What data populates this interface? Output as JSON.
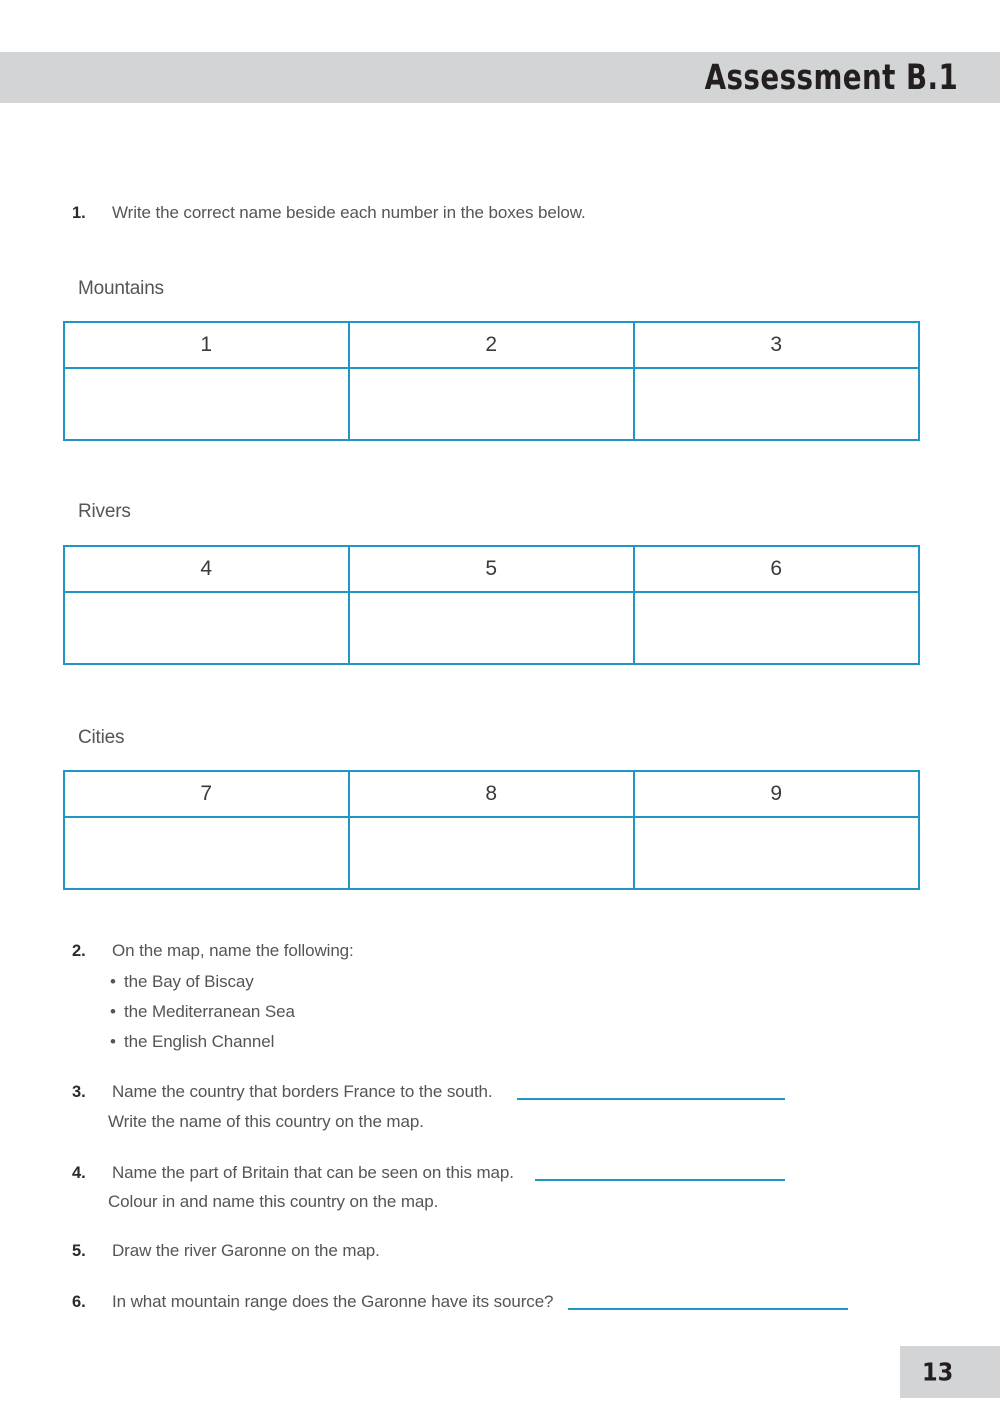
{
  "header": {
    "title": "Assessment B.1",
    "bar_color": "#d3d4d6"
  },
  "theme": {
    "accent_color": "#2196c4",
    "text_color": "#555556",
    "number_color": "#2b2b2b"
  },
  "questions": [
    {
      "number": "1.",
      "text": "Write the correct name beside each number in the boxes below."
    },
    {
      "number": "2.",
      "text": "On the map, name the following:",
      "bullets": [
        "the Bay of Biscay",
        "the Mediterranean Sea",
        "the English Channel"
      ]
    },
    {
      "number": "3.",
      "text": "Name the country that borders France to the south.",
      "sub_text": "Write the name of this country on the map.",
      "answer_line": true
    },
    {
      "number": "4.",
      "text": "Name the part of Britain that can be seen on this map.",
      "sub_text": "Colour in and name this country on the map.",
      "answer_line": true
    },
    {
      "number": "5.",
      "text": "Draw the river Garonne on the map.",
      "answer_line": false
    },
    {
      "number": "6.",
      "text": "In what mountain range does the Garonne have its source?",
      "answer_line": true
    }
  ],
  "tables": [
    {
      "label": "Mountains",
      "numbers": [
        "1",
        "2",
        "3"
      ],
      "answers": [
        "",
        "",
        ""
      ]
    },
    {
      "label": "Rivers",
      "numbers": [
        "4",
        "5",
        "6"
      ],
      "answers": [
        "",
        "",
        ""
      ]
    },
    {
      "label": "Cities",
      "numbers": [
        "7",
        "8",
        "9"
      ],
      "answers": [
        "",
        "",
        ""
      ]
    }
  ],
  "footer": {
    "page_number": "13"
  }
}
